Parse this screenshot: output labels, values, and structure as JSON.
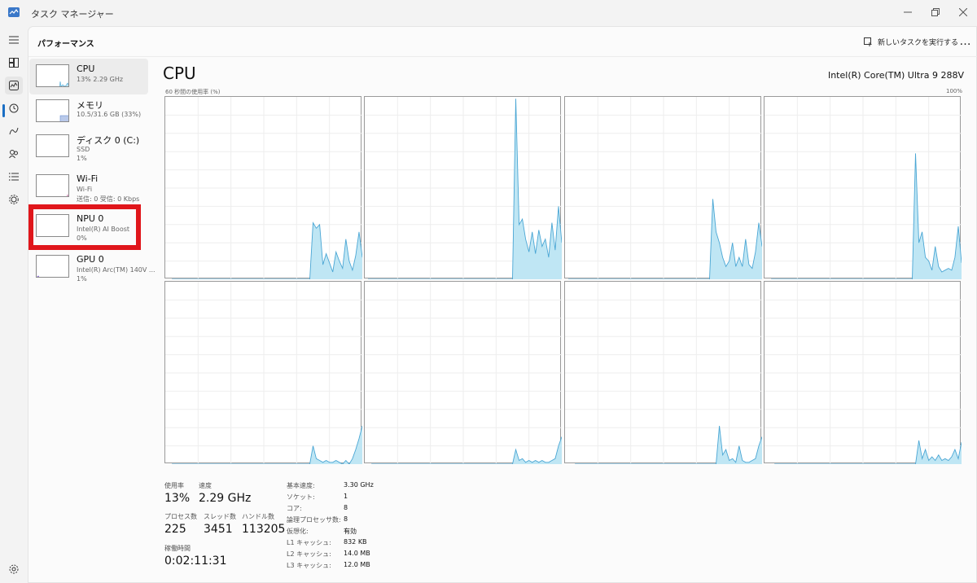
{
  "window": {
    "title": "タスク マネージャー",
    "icon": "task-manager-icon"
  },
  "header": {
    "page_title": "パフォーマンス",
    "run_task_label": "新しいタスクを実行する",
    "more_label": "…"
  },
  "nav_icons": [
    "hamburger-icon",
    "processes-icon",
    "performance-icon",
    "app-history-icon",
    "startup-icon",
    "users-icon",
    "details-icon",
    "services-icon",
    "settings-icon"
  ],
  "sidebar": {
    "items": [
      {
        "name": "CPU",
        "line1": "13% 2.29 GHz",
        "line2": ""
      },
      {
        "name": "メモリ",
        "line1": "10.5/31.6 GB (33%)",
        "line2": ""
      },
      {
        "name": "ディスク 0 (C:)",
        "line1": "SSD",
        "line2": "1%"
      },
      {
        "name": "Wi-Fi",
        "line1": "Wi-Fi",
        "line2": "送信: 0  受信: 0 Kbps"
      },
      {
        "name": "NPU 0",
        "line1": "Intel(R) AI Boost",
        "line2": "0%"
      },
      {
        "name": "GPU 0",
        "line1": "Intel(R) Arc(TM) 140V ...",
        "line2": "1%"
      }
    ]
  },
  "main": {
    "title": "CPU",
    "cpu_model": "Intel(R) Core(TM) Ultra 9 288V",
    "axis_label": "60 秒間の使用率 (%)",
    "axis_max": "100%"
  },
  "chart_data": {
    "type": "area",
    "ylim": [
      0,
      100
    ],
    "x_range_seconds": 60,
    "colors": {
      "fill": "#bfe6f4",
      "line": "#4aa6d4"
    },
    "series": [
      {
        "values": [
          0,
          0,
          0,
          0,
          0,
          0,
          0,
          0,
          0,
          0,
          0,
          0,
          0,
          0,
          0,
          0,
          0,
          0,
          0,
          0,
          0,
          0,
          0,
          0,
          0,
          0,
          0,
          0,
          0,
          0,
          0,
          0,
          0,
          0,
          0,
          0,
          0,
          0,
          0,
          0,
          0,
          0,
          0,
          0,
          0,
          0,
          0,
          0,
          0,
          0,
          0,
          0,
          0,
          0,
          0,
          0,
          0,
          0,
          0,
          0,
          0,
          0,
          0,
          0,
          0,
          0,
          0,
          0,
          0,
          0,
          0,
          0,
          0,
          0,
          0,
          0,
          0,
          0,
          0,
          0,
          0,
          0,
          0,
          0,
          0,
          0,
          0,
          0,
          0,
          0,
          0,
          0,
          0,
          0,
          0,
          0,
          0,
          0,
          0,
          0,
          0,
          0,
          0,
          0,
          0,
          0,
          0,
          0,
          0,
          0,
          0,
          0,
          0,
          0,
          0,
          0,
          0,
          0,
          0,
          0,
          0,
          0,
          0,
          0,
          0,
          0,
          0,
          0,
          0,
          0,
          0,
          0,
          0,
          0,
          0,
          0,
          0,
          0,
          0,
          0,
          0,
          0,
          0,
          0,
          0,
          0,
          0,
          0,
          0,
          0,
          0,
          0,
          0,
          0,
          0,
          0,
          0,
          0,
          0,
          0,
          0,
          0,
          0,
          0,
          0,
          0,
          0,
          0,
          0,
          0,
          0,
          0,
          0,
          0,
          0,
          0,
          0,
          0,
          0,
          0,
          0,
          0,
          0,
          0,
          0,
          0,
          0,
          0,
          0,
          0,
          0,
          0,
          0,
          0,
          0,
          0,
          0,
          0,
          0,
          0,
          0,
          0,
          0,
          0,
          0,
          0,
          0,
          0,
          0,
          0,
          0,
          0,
          0,
          0,
          0,
          0,
          0,
          0,
          0,
          0,
          0,
          0,
          0,
          0,
          0,
          0,
          0,
          0,
          0,
          0,
          0,
          0,
          0,
          0,
          0,
          0,
          0,
          0,
          0,
          0,
          0,
          0,
          0,
          0,
          0,
          0,
          0,
          0,
          0,
          0
        ]
      },
      {
        "values": [
          0
        ]
      }
    ],
    "cores": [
      [
        0,
        0,
        0,
        0,
        0,
        0,
        0,
        0,
        0,
        0,
        0,
        0,
        0,
        0,
        0,
        0,
        0,
        0,
        0,
        0,
        0,
        0,
        0,
        0,
        0,
        0,
        0,
        0,
        0,
        0,
        0,
        0,
        0,
        0,
        0,
        0,
        0,
        0,
        0,
        0,
        0,
        0,
        0,
        31,
        28,
        30,
        8,
        14,
        9,
        4,
        15,
        10,
        6,
        22,
        10,
        5,
        13,
        26,
        12
      ],
      [
        0,
        0,
        0,
        0,
        0,
        0,
        0,
        0,
        0,
        0,
        0,
        0,
        0,
        0,
        0,
        0,
        0,
        0,
        0,
        0,
        0,
        0,
        0,
        0,
        0,
        0,
        0,
        0,
        0,
        0,
        0,
        0,
        0,
        0,
        0,
        0,
        0,
        0,
        0,
        0,
        0,
        0,
        0,
        0,
        0,
        99,
        30,
        33,
        22,
        15,
        26,
        14,
        27,
        18,
        22,
        12,
        31,
        16,
        40,
        20
      ],
      [
        0,
        0,
        0,
        0,
        0,
        0,
        0,
        0,
        0,
        0,
        0,
        0,
        0,
        0,
        0,
        0,
        0,
        0,
        0,
        0,
        0,
        0,
        0,
        0,
        0,
        0,
        0,
        0,
        0,
        0,
        0,
        0,
        0,
        0,
        0,
        0,
        0,
        0,
        0,
        0,
        0,
        0,
        0,
        0,
        44,
        26,
        20,
        12,
        7,
        10,
        20,
        7,
        12,
        7,
        22,
        8,
        6,
        15,
        31,
        18
      ],
      [
        0,
        0,
        0,
        0,
        0,
        0,
        0,
        0,
        0,
        0,
        0,
        0,
        0,
        0,
        0,
        0,
        0,
        0,
        0,
        0,
        0,
        0,
        0,
        0,
        0,
        0,
        0,
        0,
        0,
        0,
        0,
        0,
        0,
        0,
        0,
        0,
        0,
        0,
        0,
        0,
        0,
        0,
        0,
        0,
        69,
        20,
        26,
        12,
        10,
        5,
        18,
        7,
        4,
        5,
        6,
        5,
        12,
        29,
        9
      ],
      [
        0,
        0,
        0,
        0,
        0,
        0,
        0,
        0,
        0,
        0,
        0,
        0,
        0,
        0,
        0,
        0,
        0,
        0,
        0,
        0,
        0,
        0,
        0,
        0,
        0,
        0,
        0,
        0,
        0,
        0,
        0,
        0,
        0,
        0,
        0,
        0,
        0,
        0,
        0,
        0,
        0,
        0,
        0,
        10,
        3,
        2,
        1,
        2,
        1,
        1,
        2,
        1,
        0,
        2,
        0,
        3,
        8,
        14,
        21
      ],
      [
        0,
        0,
        0,
        0,
        0,
        0,
        0,
        0,
        0,
        0,
        0,
        0,
        0,
        0,
        0,
        0,
        0,
        0,
        0,
        0,
        0,
        0,
        0,
        0,
        0,
        0,
        0,
        0,
        0,
        0,
        0,
        0,
        0,
        0,
        0,
        0,
        0,
        0,
        0,
        0,
        0,
        0,
        0,
        0,
        8,
        2,
        3,
        1,
        2,
        1,
        2,
        1,
        2,
        1,
        1,
        2,
        3,
        10,
        15
      ],
      [
        0,
        0,
        0,
        0,
        0,
        0,
        0,
        0,
        0,
        0,
        0,
        0,
        0,
        0,
        0,
        0,
        0,
        0,
        0,
        0,
        0,
        0,
        0,
        0,
        0,
        0,
        0,
        0,
        0,
        0,
        0,
        0,
        0,
        0,
        0,
        0,
        0,
        0,
        0,
        0,
        0,
        0,
        0,
        0,
        21,
        5,
        8,
        2,
        3,
        1,
        10,
        2,
        1,
        1,
        2,
        3,
        10,
        15
      ],
      [
        0,
        0,
        0,
        0,
        0,
        0,
        0,
        0,
        0,
        0,
        0,
        0,
        0,
        0,
        0,
        0,
        0,
        0,
        0,
        0,
        0,
        0,
        0,
        0,
        0,
        0,
        0,
        0,
        0,
        0,
        0,
        0,
        0,
        0,
        0,
        0,
        0,
        0,
        0,
        0,
        0,
        0,
        0,
        0,
        13,
        3,
        8,
        2,
        4,
        2,
        5,
        2,
        3,
        2,
        4,
        8,
        3,
        12
      ]
    ]
  },
  "stats": {
    "usage_label": "使用率",
    "usage_value": "13%",
    "speed_label": "速度",
    "speed_value": "2.29 GHz",
    "processes_label": "プロセス数",
    "processes_value": "225",
    "threads_label": "スレッド数",
    "threads_value": "3451",
    "handles_label": "ハンドル数",
    "handles_value": "113205",
    "uptime_label": "稼働時間",
    "uptime_value": "0:02:11:31"
  },
  "specs": [
    {
      "label": "基本速度:",
      "value": "3.30 GHz"
    },
    {
      "label": "ソケット:",
      "value": "1"
    },
    {
      "label": "コア:",
      "value": "8"
    },
    {
      "label": "論理プロセッサ数:",
      "value": "8"
    },
    {
      "label": "仮想化:",
      "value": "有効"
    },
    {
      "label": "L1 キャッシュ:",
      "value": "832 KB"
    },
    {
      "label": "L2 キャッシュ:",
      "value": "14.0 MB"
    },
    {
      "label": "L3 キャッシュ:",
      "value": "12.0 MB"
    }
  ]
}
